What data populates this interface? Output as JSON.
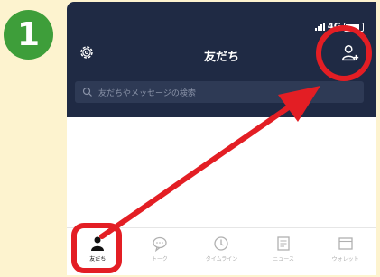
{
  "step": {
    "number": "1"
  },
  "status_bar": {
    "network": "4G"
  },
  "header": {
    "title": "友だち",
    "settings_icon": "gear-icon",
    "add_friend_icon": "add-friend-icon"
  },
  "search": {
    "placeholder": "友だちやメッセージの検索"
  },
  "tabs": [
    {
      "label": "友だち",
      "icon": "person-icon",
      "active": true
    },
    {
      "label": "トーク",
      "icon": "chat-bubble-icon",
      "active": false
    },
    {
      "label": "タイムライン",
      "icon": "clock-icon",
      "active": false
    },
    {
      "label": "ニュース",
      "icon": "news-icon",
      "active": false
    },
    {
      "label": "ウォレット",
      "icon": "wallet-icon",
      "active": false
    }
  ],
  "colors": {
    "background": "#fdf3cf",
    "badge": "#3e9e3a",
    "header": "#1f2a44",
    "highlight": "#e31e24"
  }
}
